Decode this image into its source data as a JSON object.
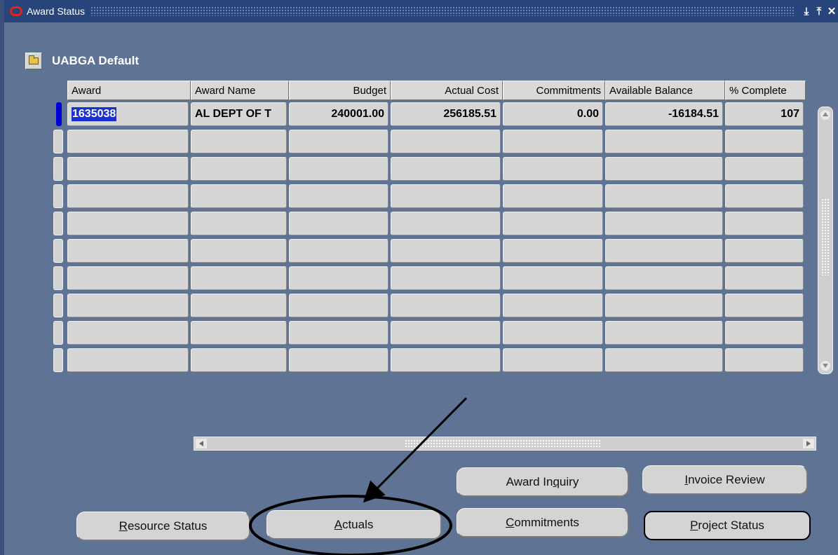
{
  "window": {
    "title": "Award Status",
    "controls": [
      "minimize-icon",
      "maximize-icon",
      "close-icon"
    ],
    "control_glyphs": [
      "⤓",
      "⤒",
      "✕"
    ]
  },
  "folder": {
    "name": "UABGA Default",
    "icon": "open-folder-icon"
  },
  "table": {
    "columns": [
      "Award",
      "Award Name",
      "Budget",
      "Actual Cost",
      "Commitments",
      "Available Balance",
      "% Complete"
    ],
    "rows": [
      {
        "award": "1635038",
        "award_name": "AL DEPT OF T",
        "budget": "240001.00",
        "actual_cost": "256185.51",
        "commitments": "0.00",
        "available_balance": "-16184.51",
        "pct_complete": "107"
      },
      {
        "award": "",
        "award_name": "",
        "budget": "",
        "actual_cost": "",
        "commitments": "",
        "available_balance": "",
        "pct_complete": ""
      },
      {
        "award": "",
        "award_name": "",
        "budget": "",
        "actual_cost": "",
        "commitments": "",
        "available_balance": "",
        "pct_complete": ""
      },
      {
        "award": "",
        "award_name": "",
        "budget": "",
        "actual_cost": "",
        "commitments": "",
        "available_balance": "",
        "pct_complete": ""
      },
      {
        "award": "",
        "award_name": "",
        "budget": "",
        "actual_cost": "",
        "commitments": "",
        "available_balance": "",
        "pct_complete": ""
      },
      {
        "award": "",
        "award_name": "",
        "budget": "",
        "actual_cost": "",
        "commitments": "",
        "available_balance": "",
        "pct_complete": ""
      },
      {
        "award": "",
        "award_name": "",
        "budget": "",
        "actual_cost": "",
        "commitments": "",
        "available_balance": "",
        "pct_complete": ""
      },
      {
        "award": "",
        "award_name": "",
        "budget": "",
        "actual_cost": "",
        "commitments": "",
        "available_balance": "",
        "pct_complete": ""
      },
      {
        "award": "",
        "award_name": "",
        "budget": "",
        "actual_cost": "",
        "commitments": "",
        "available_balance": "",
        "pct_complete": ""
      },
      {
        "award": "",
        "award_name": "",
        "budget": "",
        "actual_cost": "",
        "commitments": "",
        "available_balance": "",
        "pct_complete": ""
      }
    ]
  },
  "buttons": {
    "award_inquiry": {
      "pre": "Award In",
      "mnemonic": "q",
      "post": "uiry"
    },
    "invoice_review": {
      "pre": "",
      "mnemonic": "I",
      "post": "nvoice Review"
    },
    "resource_status": {
      "pre": "",
      "mnemonic": "R",
      "post": "esource Status"
    },
    "actuals": {
      "pre": "",
      "mnemonic": "A",
      "post": "ctuals"
    },
    "commitments": {
      "pre": "",
      "mnemonic": "C",
      "post": "ommitments"
    },
    "project_status": {
      "pre": "",
      "mnemonic": "P",
      "post": "roject Status"
    }
  },
  "colors": {
    "canvas": "#5f7394",
    "titlebar": "#27457a",
    "selection": "#1a2fd0",
    "field": "#d6d6d6"
  }
}
